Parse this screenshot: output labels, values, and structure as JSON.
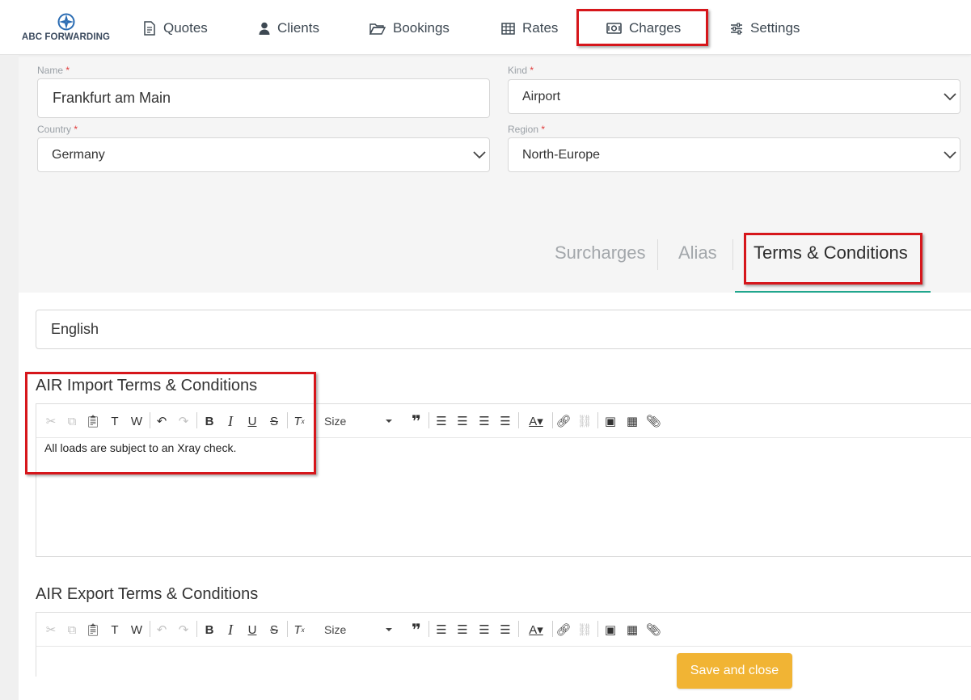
{
  "brand": {
    "name": "ABC FORWARDING"
  },
  "nav": {
    "items": [
      {
        "label": "Quotes",
        "icon": "document-icon"
      },
      {
        "label": "Clients",
        "icon": "user-icon"
      },
      {
        "label": "Bookings",
        "icon": "folder-open-icon"
      },
      {
        "label": "Rates",
        "icon": "table-icon"
      },
      {
        "label": "Charges",
        "icon": "money-icon"
      },
      {
        "label": "Settings",
        "icon": "sliders-icon"
      }
    ]
  },
  "form": {
    "name": {
      "label": "Name",
      "required": "*",
      "value": "Frankfurt am Main"
    },
    "kind": {
      "label": "Kind",
      "required": "*",
      "value": "Airport"
    },
    "country": {
      "label": "Country",
      "required": "*",
      "value": "Germany"
    },
    "region": {
      "label": "Region",
      "required": "*",
      "value": "North-Europe"
    }
  },
  "tabs": {
    "surcharges": "Surcharges",
    "alias": "Alias",
    "terms": "Terms & Conditions"
  },
  "language": {
    "value": "English"
  },
  "editors": {
    "import": {
      "title": "AIR Import Terms & Conditions",
      "content": "All loads are subject to an Xray check."
    },
    "export": {
      "title": "AIR Export Terms & Conditions",
      "content": ""
    },
    "size_label": "Size"
  },
  "actions": {
    "save_close": "Save and close"
  },
  "colors": {
    "accent": "#21a68d",
    "highlight": "#d6161b",
    "save_button": "#f1b434"
  }
}
